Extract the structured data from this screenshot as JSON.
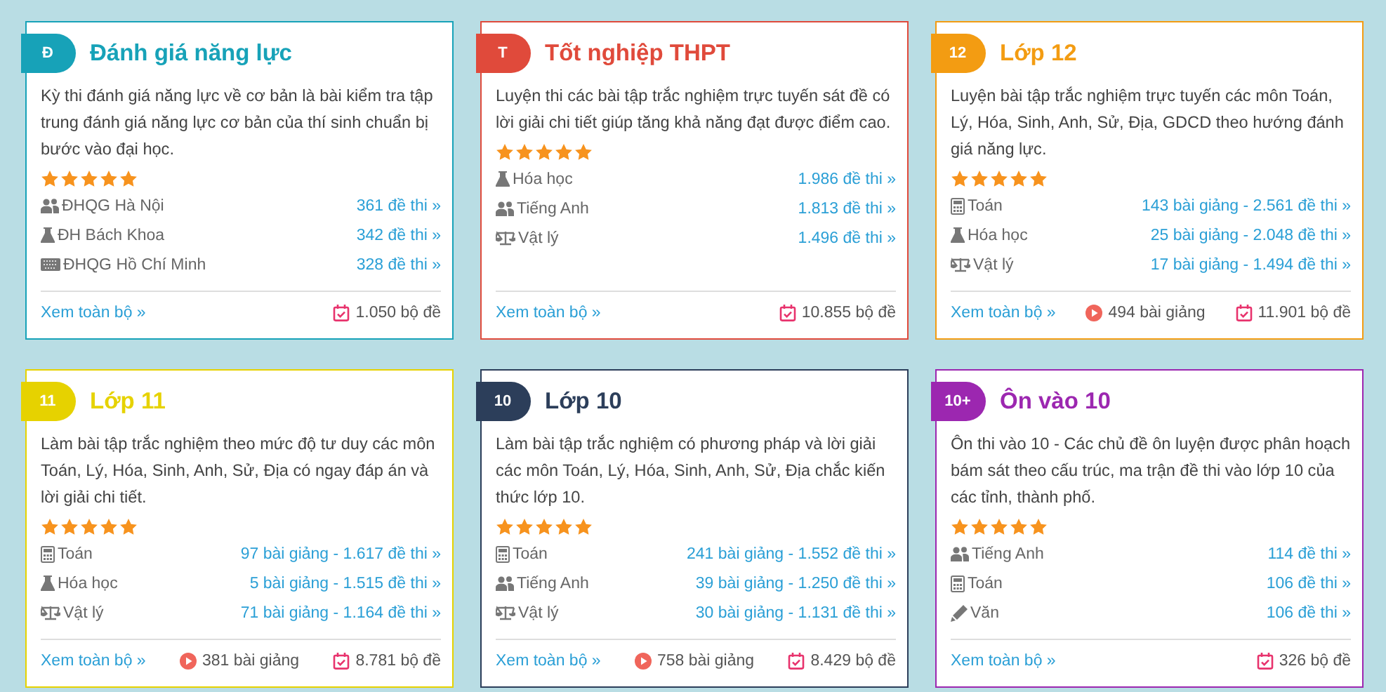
{
  "cards": [
    {
      "badge": "Đ",
      "title": "Đánh giá năng lực",
      "color": "#17a2b8",
      "description": "Kỳ thi đánh giá năng lực về cơ bản là bài kiểm tra tập trung đánh giá năng lực cơ bản của thí sinh chuẩn bị bước vào đại học.",
      "stars": 5,
      "subjects": [
        {
          "kind": "users",
          "name": "ĐHQG Hà Nội",
          "count": "361 đề thi »"
        },
        {
          "kind": "flask",
          "name": "ĐH Bách Khoa",
          "count": "342 đề thi »"
        },
        {
          "kind": "keyboard",
          "name": "ĐHQG Hồ Chí Minh",
          "count": "328 đề thi »"
        }
      ],
      "link": "Xem toàn bộ »",
      "sets": "1.050 bộ đề"
    },
    {
      "badge": "T",
      "title": "Tốt nghiệp THPT",
      "color": "#e04a3b",
      "description": "Luyện thi các bài tập trắc nghiệm trực tuyến sát đề có lời giải chi tiết giúp tăng khả năng đạt được điểm cao.",
      "stars": 5,
      "subjects": [
        {
          "kind": "flask",
          "name": "Hóa học",
          "count": "1.986 đề thi »"
        },
        {
          "kind": "users",
          "name": "Tiếng Anh",
          "count": "1.813 đề thi »"
        },
        {
          "kind": "scale",
          "name": "Vật lý",
          "count": "1.496 đề thi »"
        }
      ],
      "link": "Xem toàn bộ »",
      "sets": "10.855 bộ đề"
    },
    {
      "badge": "12",
      "title": "Lớp 12",
      "color": "#f39c12",
      "description": "Luyện bài tập trắc nghiệm trực tuyến các môn Toán, Lý, Hóa, Sinh, Anh, Sử, Địa, GDCD theo hướng đánh giá năng lực.",
      "stars": 5,
      "subjects": [
        {
          "kind": "calculator",
          "name": "Toán",
          "count": "143 bài giảng - 2.561 đề thi »"
        },
        {
          "kind": "flask",
          "name": "Hóa học",
          "count": "25 bài giảng - 2.048 đề thi »"
        },
        {
          "kind": "scale",
          "name": "Vật lý",
          "count": "17 bài giảng - 1.494 đề thi »"
        }
      ],
      "link": "Xem toàn bộ »",
      "lessons": "494 bài giảng",
      "sets": "11.901 bộ đề"
    },
    {
      "badge": "11",
      "title": "Lớp 11",
      "color": "#e6d200",
      "description": "Làm bài tập trắc nghiệm theo mức độ tư duy các môn Toán, Lý, Hóa, Sinh, Anh, Sử, Địa có ngay đáp án và lời giải chi tiết.",
      "stars": 5,
      "subjects": [
        {
          "kind": "calculator",
          "name": "Toán",
          "count": "97 bài giảng - 1.617 đề thi »"
        },
        {
          "kind": "flask",
          "name": "Hóa học",
          "count": "5 bài giảng - 1.515 đề thi »"
        },
        {
          "kind": "scale",
          "name": "Vật lý",
          "count": "71 bài giảng - 1.164 đề thi »"
        }
      ],
      "link": "Xem toàn bộ »",
      "lessons": "381 bài giảng",
      "sets": "8.781 bộ đề"
    },
    {
      "badge": "10",
      "title": "Lớp 10",
      "color": "#2c3e5a",
      "description": "Làm bài tập trắc nghiệm có phương pháp và lời giải các môn Toán, Lý, Hóa, Sinh, Anh, Sử, Địa chắc kiến thức lớp 10.",
      "stars": 5,
      "subjects": [
        {
          "kind": "calculator",
          "name": "Toán",
          "count": "241 bài giảng - 1.552 đề thi »"
        },
        {
          "kind": "users",
          "name": "Tiếng Anh",
          "count": "39 bài giảng - 1.250 đề thi »"
        },
        {
          "kind": "scale",
          "name": "Vật lý",
          "count": "30 bài giảng - 1.131 đề thi »"
        }
      ],
      "link": "Xem toàn bộ »",
      "lessons": "758 bài giảng",
      "sets": "8.429 bộ đề"
    },
    {
      "badge": "10+",
      "title": "Ôn vào 10",
      "color": "#9c27b0",
      "description": "Ôn thi vào 10 - Các chủ đề ôn luyện được phân hoạch bám sát theo cấu trúc, ma trận đề thi vào lớp 10 của các tỉnh, thành phố.",
      "stars": 5,
      "subjects": [
        {
          "kind": "users",
          "name": "Tiếng Anh",
          "count": "114 đề thi »"
        },
        {
          "kind": "calculator",
          "name": "Toán",
          "count": "106 đề thi »"
        },
        {
          "kind": "pencil",
          "name": "Văn",
          "count": "106 đề thi »"
        }
      ],
      "link": "Xem toàn bộ »",
      "sets": "326 bộ đề"
    }
  ]
}
